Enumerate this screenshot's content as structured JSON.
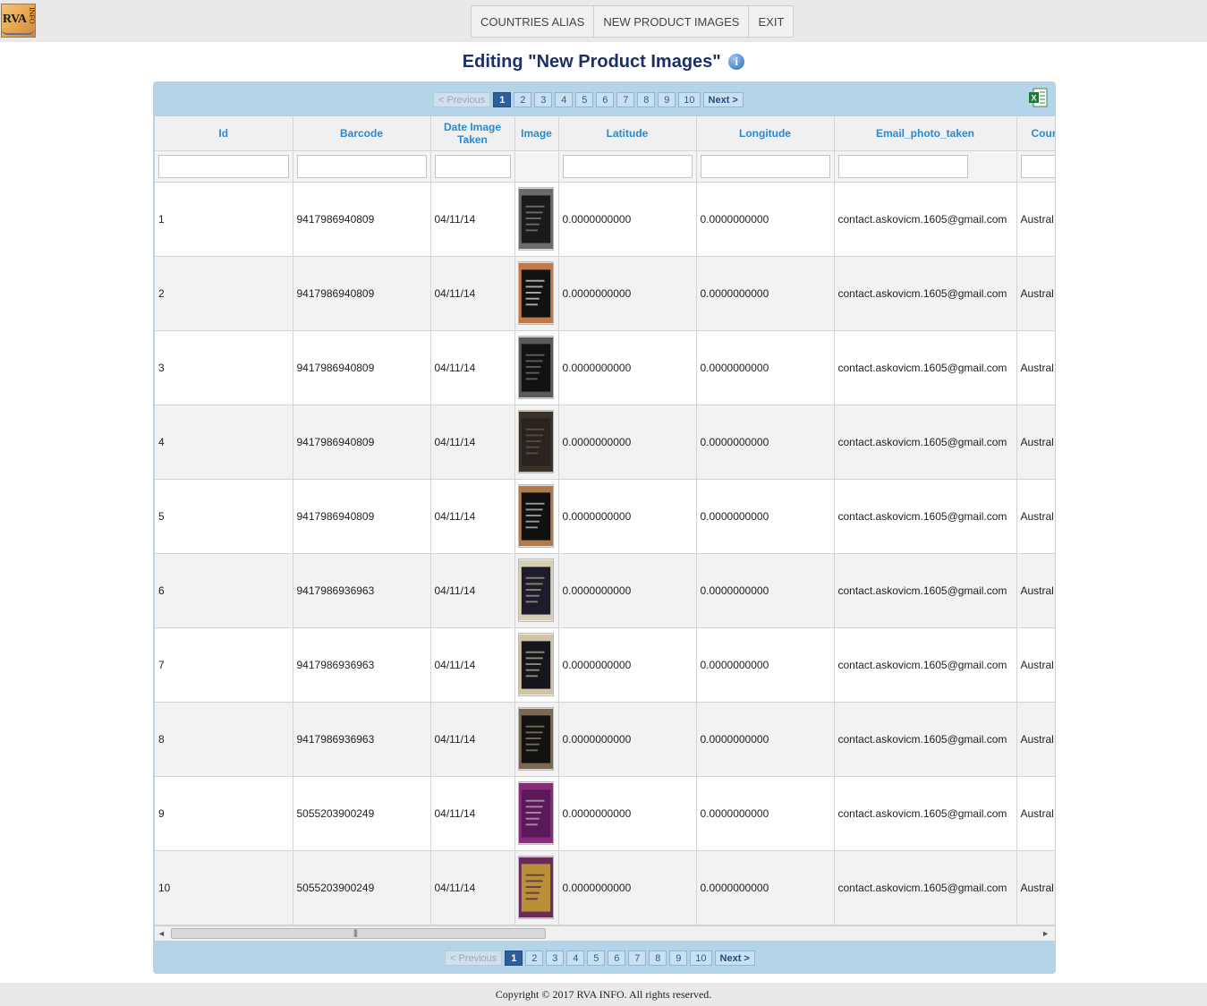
{
  "logo": {
    "text": "RVA",
    "subtext": "INFO"
  },
  "nav": [
    {
      "label": "COUNTRIES ALIAS"
    },
    {
      "label": "NEW PRODUCT IMAGES"
    },
    {
      "label": "EXIT"
    }
  ],
  "page_title": "Editing \"New Product Images\"",
  "info_icon_glyph": "i",
  "pager": {
    "previous": "< Previous",
    "next": "Next >",
    "pages": [
      "1",
      "2",
      "3",
      "4",
      "5",
      "6",
      "7",
      "8",
      "9",
      "10"
    ],
    "current": "1"
  },
  "columns": [
    {
      "label": "Id"
    },
    {
      "label": "Barcode"
    },
    {
      "label": "Date Image Taken"
    },
    {
      "label": "Image"
    },
    {
      "label": "Latitude"
    },
    {
      "label": "Longitude"
    },
    {
      "label": "Email_photo_taken"
    },
    {
      "label": "Coun"
    }
  ],
  "rows": [
    {
      "id": "1",
      "barcode": "9417986940809",
      "date": "04/11/14",
      "lat": "0.0000000000",
      "lon": "0.0000000000",
      "email": "contact.askovicm.1605@gmail.com",
      "country": "Austral",
      "img_colors": [
        "#6b6b6b",
        "#1a1a1a",
        "#8a8a8a"
      ]
    },
    {
      "id": "2",
      "barcode": "9417986940809",
      "date": "04/11/14",
      "lat": "0.0000000000",
      "lon": "0.0000000000",
      "email": "contact.askovicm.1605@gmail.com",
      "country": "Austral",
      "img_colors": [
        "#c07a4a",
        "#111111",
        "#e8e8e8"
      ]
    },
    {
      "id": "3",
      "barcode": "9417986940809",
      "date": "04/11/14",
      "lat": "0.0000000000",
      "lon": "0.0000000000",
      "email": "contact.askovicm.1605@gmail.com",
      "country": "Austral",
      "img_colors": [
        "#5a5a5a",
        "#121212",
        "#7a7a7a"
      ]
    },
    {
      "id": "4",
      "barcode": "9417986940809",
      "date": "04/11/14",
      "lat": "0.0000000000",
      "lon": "0.0000000000",
      "email": "contact.askovicm.1605@gmail.com",
      "country": "Austral",
      "img_colors": [
        "#3a3128",
        "#2a2420",
        "#6a5a48"
      ]
    },
    {
      "id": "5",
      "barcode": "9417986940809",
      "date": "04/11/14",
      "lat": "0.0000000000",
      "lon": "0.0000000000",
      "email": "contact.askovicm.1605@gmail.com",
      "country": "Austral",
      "img_colors": [
        "#b07a4a",
        "#101010",
        "#d0d0d0"
      ]
    },
    {
      "id": "6",
      "barcode": "9417986936963",
      "date": "04/11/14",
      "lat": "0.0000000000",
      "lon": "0.0000000000",
      "email": "contact.askovicm.1605@gmail.com",
      "country": "Austral",
      "img_colors": [
        "#d8cdb5",
        "#1c1c2a",
        "#b9a98a"
      ]
    },
    {
      "id": "7",
      "barcode": "9417986936963",
      "date": "04/11/14",
      "lat": "0.0000000000",
      "lon": "0.0000000000",
      "email": "contact.askovicm.1605@gmail.com",
      "country": "Austral",
      "img_colors": [
        "#d2c3a4",
        "#15151d",
        "#c8b898"
      ]
    },
    {
      "id": "8",
      "barcode": "9417986936963",
      "date": "04/11/14",
      "lat": "0.0000000000",
      "lon": "0.0000000000",
      "email": "contact.askovicm.1605@gmail.com",
      "country": "Austral",
      "img_colors": [
        "#7a6a55",
        "#121212",
        "#9a8a70"
      ]
    },
    {
      "id": "9",
      "barcode": "5055203900249",
      "date": "04/11/14",
      "lat": "0.0000000000",
      "lon": "0.0000000000",
      "email": "contact.askovicm.1605@gmail.com",
      "country": "Austral",
      "img_colors": [
        "#8a2a7a",
        "#5a1a5a",
        "#d0b0c8"
      ]
    },
    {
      "id": "10",
      "barcode": "5055203900249",
      "date": "04/11/14",
      "lat": "0.0000000000",
      "lon": "0.0000000000",
      "email": "contact.askovicm.1605@gmail.com",
      "country": "Austral",
      "img_colors": [
        "#6a2a5a",
        "#b8903a",
        "#4a1a40"
      ]
    }
  ],
  "footer": {
    "copyright": "Copyright © 2017 RVA INFO. All rights reserved."
  },
  "icons": {
    "excel": "excel-export-icon",
    "info": "info-icon",
    "scroll_left": "scroll-left-arrow-icon",
    "scroll_right": "scroll-right-arrow-icon"
  }
}
